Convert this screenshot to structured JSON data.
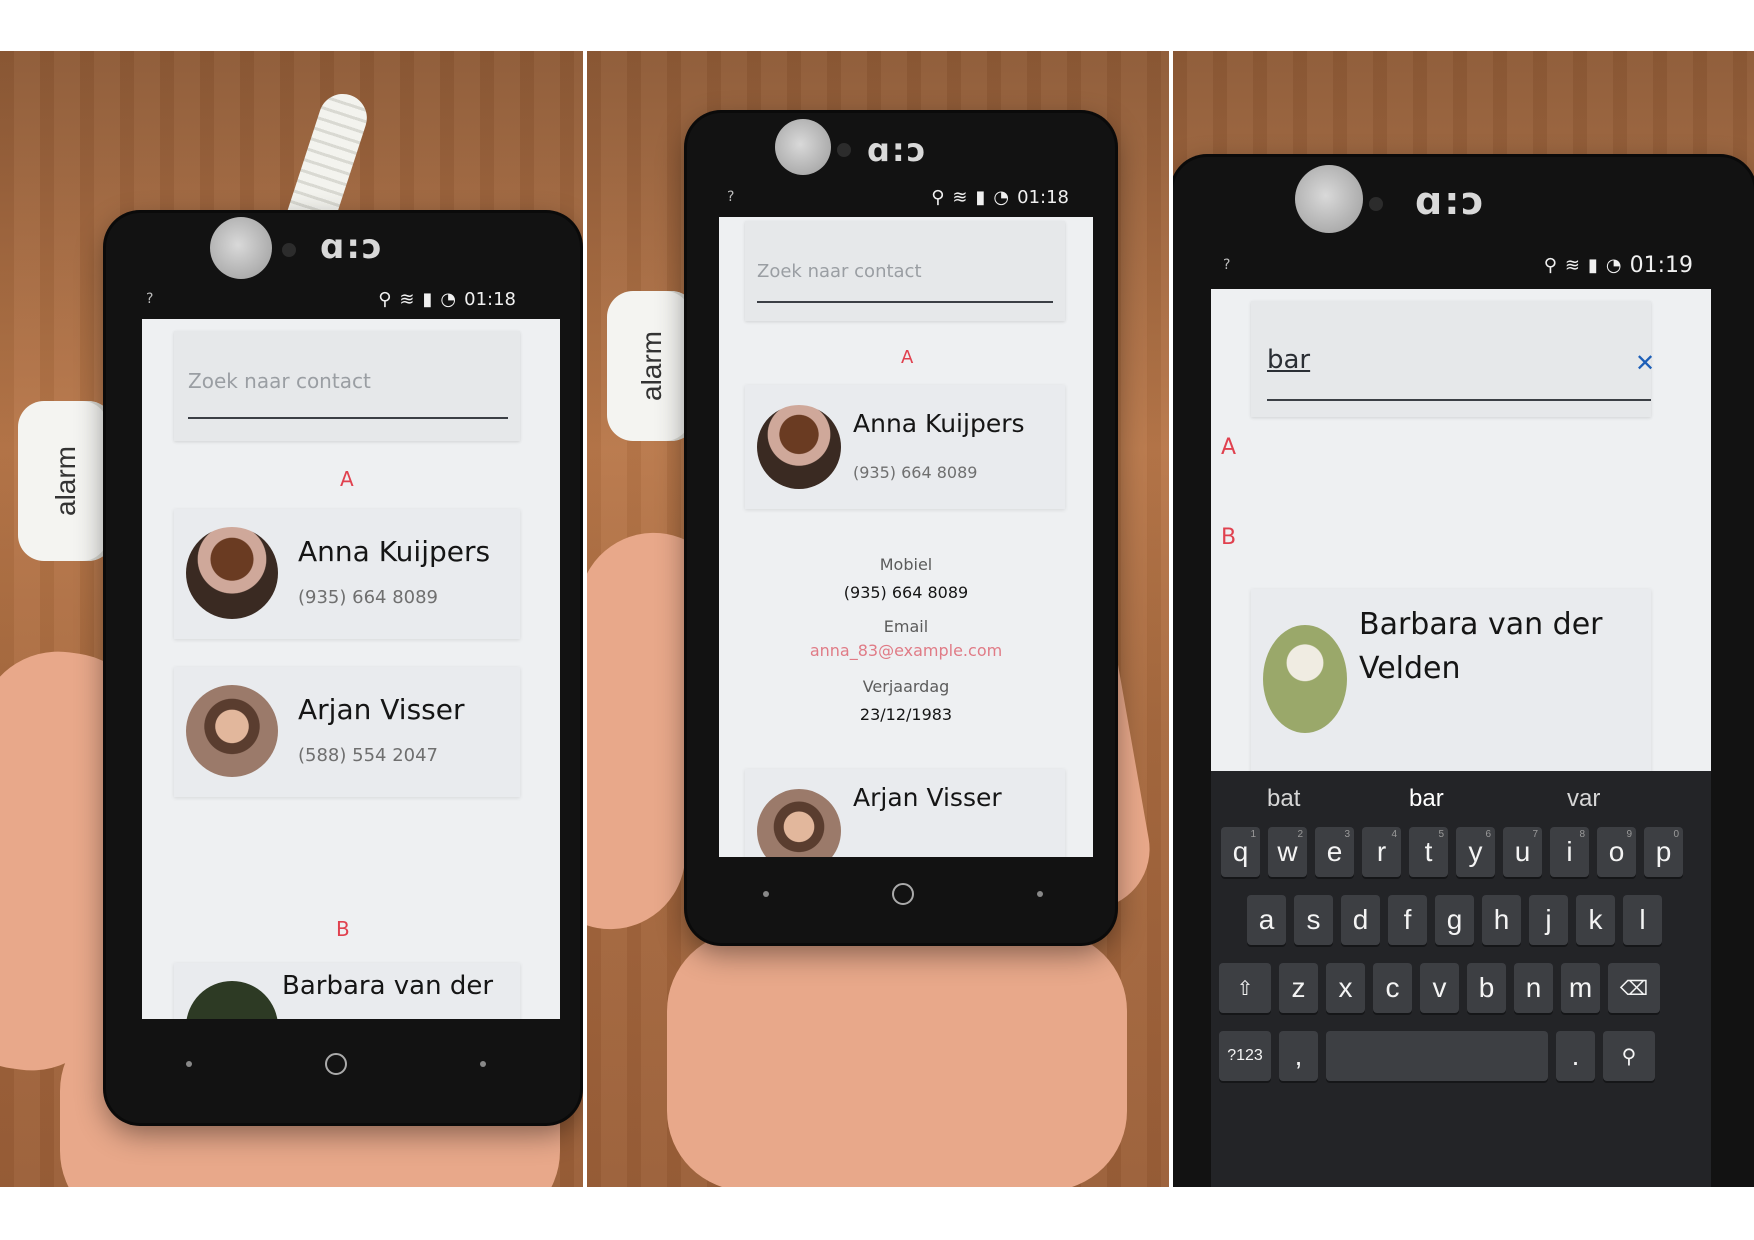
{
  "status_bar": {
    "panel1_time": "01:18",
    "panel2_time": "01:18",
    "panel3_time": "01:19"
  },
  "alarm_label": "alarm",
  "search": {
    "placeholder": "Zoek naar contact",
    "query": "bar",
    "clear_icon": "✕"
  },
  "sections": {
    "a": "A",
    "b": "B"
  },
  "contacts": [
    {
      "name": "Anna Kuijpers",
      "phone": "(935) 664 8089"
    },
    {
      "name": "Arjan Visser",
      "phone": "(588) 554 2047"
    },
    {
      "name": "Barbara van der Velden",
      "name_line1": "Barbara van der",
      "name_line2": "Velden"
    }
  ],
  "detail": {
    "mobile_label": "Mobiel",
    "mobile_value": "(935) 664 8089",
    "email_label": "Email",
    "email_value": "anna_83@example.com",
    "birthday_label": "Verjaardag",
    "birthday_value": "23/12/1983"
  },
  "keyboard": {
    "suggestions": [
      "bat",
      "bar",
      "var"
    ],
    "row1": [
      "q",
      "w",
      "e",
      "r",
      "t",
      "y",
      "u",
      "i",
      "o",
      "p"
    ],
    "row1_hints": [
      "1",
      "2",
      "3",
      "4",
      "5",
      "6",
      "7",
      "8",
      "9",
      "0"
    ],
    "row2": [
      "a",
      "s",
      "d",
      "f",
      "g",
      "h",
      "j",
      "k",
      "l"
    ],
    "row3": [
      "z",
      "x",
      "c",
      "v",
      "b",
      "n",
      "m"
    ],
    "symbols_key": "?123",
    "comma_key": ",",
    "period_key": "."
  },
  "colors": {
    "accent_red": "#e0414f",
    "clear_blue": "#1d5fb8",
    "screen_bg": "#eef0f2"
  }
}
